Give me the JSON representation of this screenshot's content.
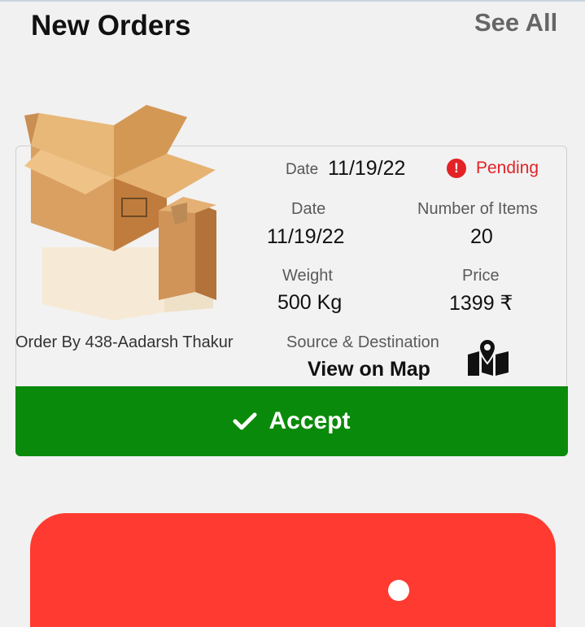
{
  "header": {
    "title": "New Orders",
    "see_all": "See All"
  },
  "order": {
    "date_top_label": "Date",
    "date_top_value": "11/19/22",
    "status": "Pending",
    "status_icon": "exclamation-circle-icon",
    "date_label": "Date",
    "date_value": "11/19/22",
    "items_label": "Number of Items",
    "items_value": "20",
    "weight_label": "Weight",
    "weight_value": "500 Kg",
    "price_label": "Price",
    "price_value": "1399 ₹",
    "order_by": "Order By 438-Aadarsh Thakur",
    "source_label": "Source & Destination",
    "map_link": "View on Map",
    "map_icon": "map-pin-icon",
    "accept_label": "Accept",
    "accept_icon": "check-icon"
  },
  "colors": {
    "accept": "#0a8a0a",
    "pending": "#e32226",
    "bottom_panel": "#ff3a30"
  }
}
